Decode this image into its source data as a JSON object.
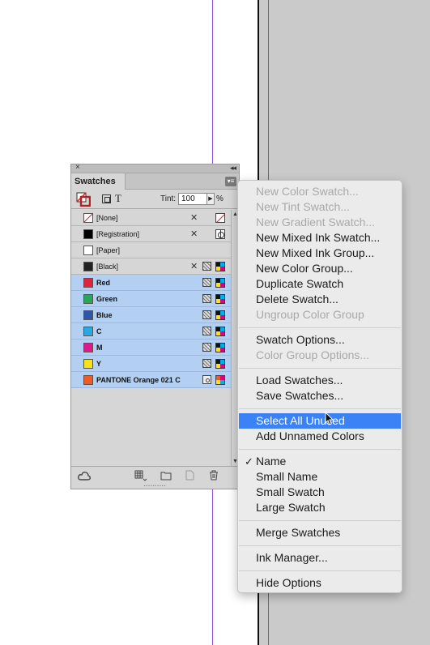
{
  "panel": {
    "tab_label": "Swatches",
    "close_glyph": "×",
    "collapse_glyph": "◂◂",
    "menu_glyph": "▾≡",
    "toolbar": {
      "tint_label": "Tint:",
      "tint_value": "100",
      "tint_arrow": "▶",
      "tint_unit": "%",
      "text_toggle": "T"
    },
    "swatches": [
      {
        "name": "[None]",
        "color": "none",
        "selected": false,
        "bold": false
      },
      {
        "name": "[Registration]",
        "color": "#000000",
        "selected": false,
        "bold": false
      },
      {
        "name": "[Paper]",
        "color": "#ffffff",
        "selected": false,
        "bold": false
      },
      {
        "name": "[Black]",
        "color": "#222222",
        "selected": false,
        "bold": false
      },
      {
        "name": "Red",
        "color": "#e1243a",
        "selected": true,
        "bold": true
      },
      {
        "name": "Green",
        "color": "#2aa55a",
        "selected": true,
        "bold": true
      },
      {
        "name": "Blue",
        "color": "#2f56a8",
        "selected": true,
        "bold": true
      },
      {
        "name": "C",
        "color": "#2aa8e0",
        "selected": true,
        "bold": true
      },
      {
        "name": "M",
        "color": "#e0198a",
        "selected": true,
        "bold": true
      },
      {
        "name": "Y",
        "color": "#f5e316",
        "selected": true,
        "bold": true
      },
      {
        "name": "PANTONE Orange 021 C",
        "color": "#f05a23",
        "selected": true,
        "bold": true
      }
    ]
  },
  "menu": {
    "items": [
      {
        "label": "New Color Swatch...",
        "disabled": true
      },
      {
        "label": "New Tint Swatch...",
        "disabled": true
      },
      {
        "label": "New Gradient Swatch...",
        "disabled": true
      },
      {
        "label": "New Mixed Ink Swatch...",
        "disabled": false
      },
      {
        "label": "New Mixed Ink Group...",
        "disabled": false
      },
      {
        "label": "New Color Group...",
        "disabled": false
      },
      {
        "label": "Duplicate Swatch",
        "disabled": false
      },
      {
        "label": "Delete Swatch...",
        "disabled": false
      },
      {
        "label": "Ungroup Color Group",
        "disabled": true
      },
      {
        "label": "Swatch Options...",
        "disabled": false
      },
      {
        "label": "Color Group Options...",
        "disabled": true
      },
      {
        "label": "Load Swatches...",
        "disabled": false
      },
      {
        "label": "Save Swatches...",
        "disabled": false
      },
      {
        "label": "Select All Unused",
        "disabled": false,
        "highlighted": true
      },
      {
        "label": "Add Unnamed Colors",
        "disabled": false
      },
      {
        "label": "Name",
        "disabled": false,
        "checked": true
      },
      {
        "label": "Small Name",
        "disabled": false
      },
      {
        "label": "Small Swatch",
        "disabled": false
      },
      {
        "label": "Large Swatch",
        "disabled": false
      },
      {
        "label": "Merge Swatches",
        "disabled": false
      },
      {
        "label": "Ink Manager...",
        "disabled": false
      },
      {
        "label": "Hide Options",
        "disabled": false
      }
    ],
    "check_glyph": "✓",
    "highlight_color": "#3a82f6"
  },
  "icons": {
    "no_edit": "✕",
    "scroll_up": "▲",
    "scroll_down": "▼",
    "grip": "▪▪▪▪▪▪▪▪▪▪"
  }
}
